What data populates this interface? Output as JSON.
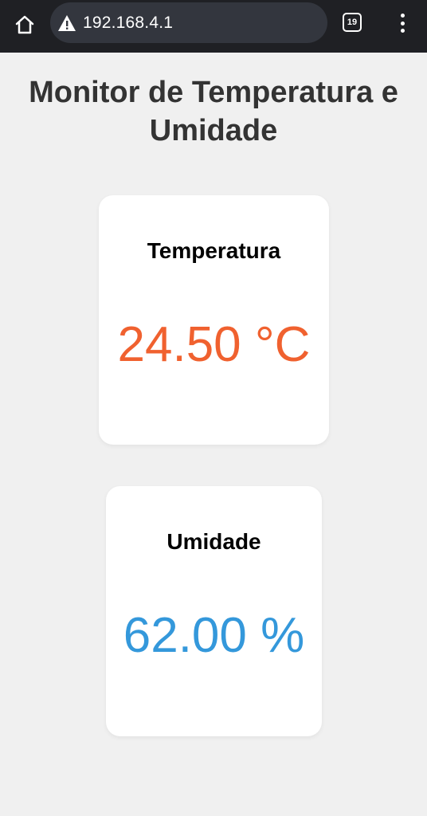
{
  "browser": {
    "url": "192.168.4.1",
    "tab_count": "19",
    "bar_color": "#1f2024"
  },
  "page": {
    "title": "Monitor de Temperatura e Umidade"
  },
  "cards": {
    "temperature": {
      "label": "Temperatura",
      "value": "24.50 °C",
      "color": "#f0612f"
    },
    "humidity": {
      "label": "Umidade",
      "value": "62.00 %",
      "color": "#3498db"
    }
  },
  "icons": {
    "home": "home-icon",
    "warning": "warning-icon",
    "tabs": "tabs-icon",
    "menu": "more-vert-icon"
  }
}
